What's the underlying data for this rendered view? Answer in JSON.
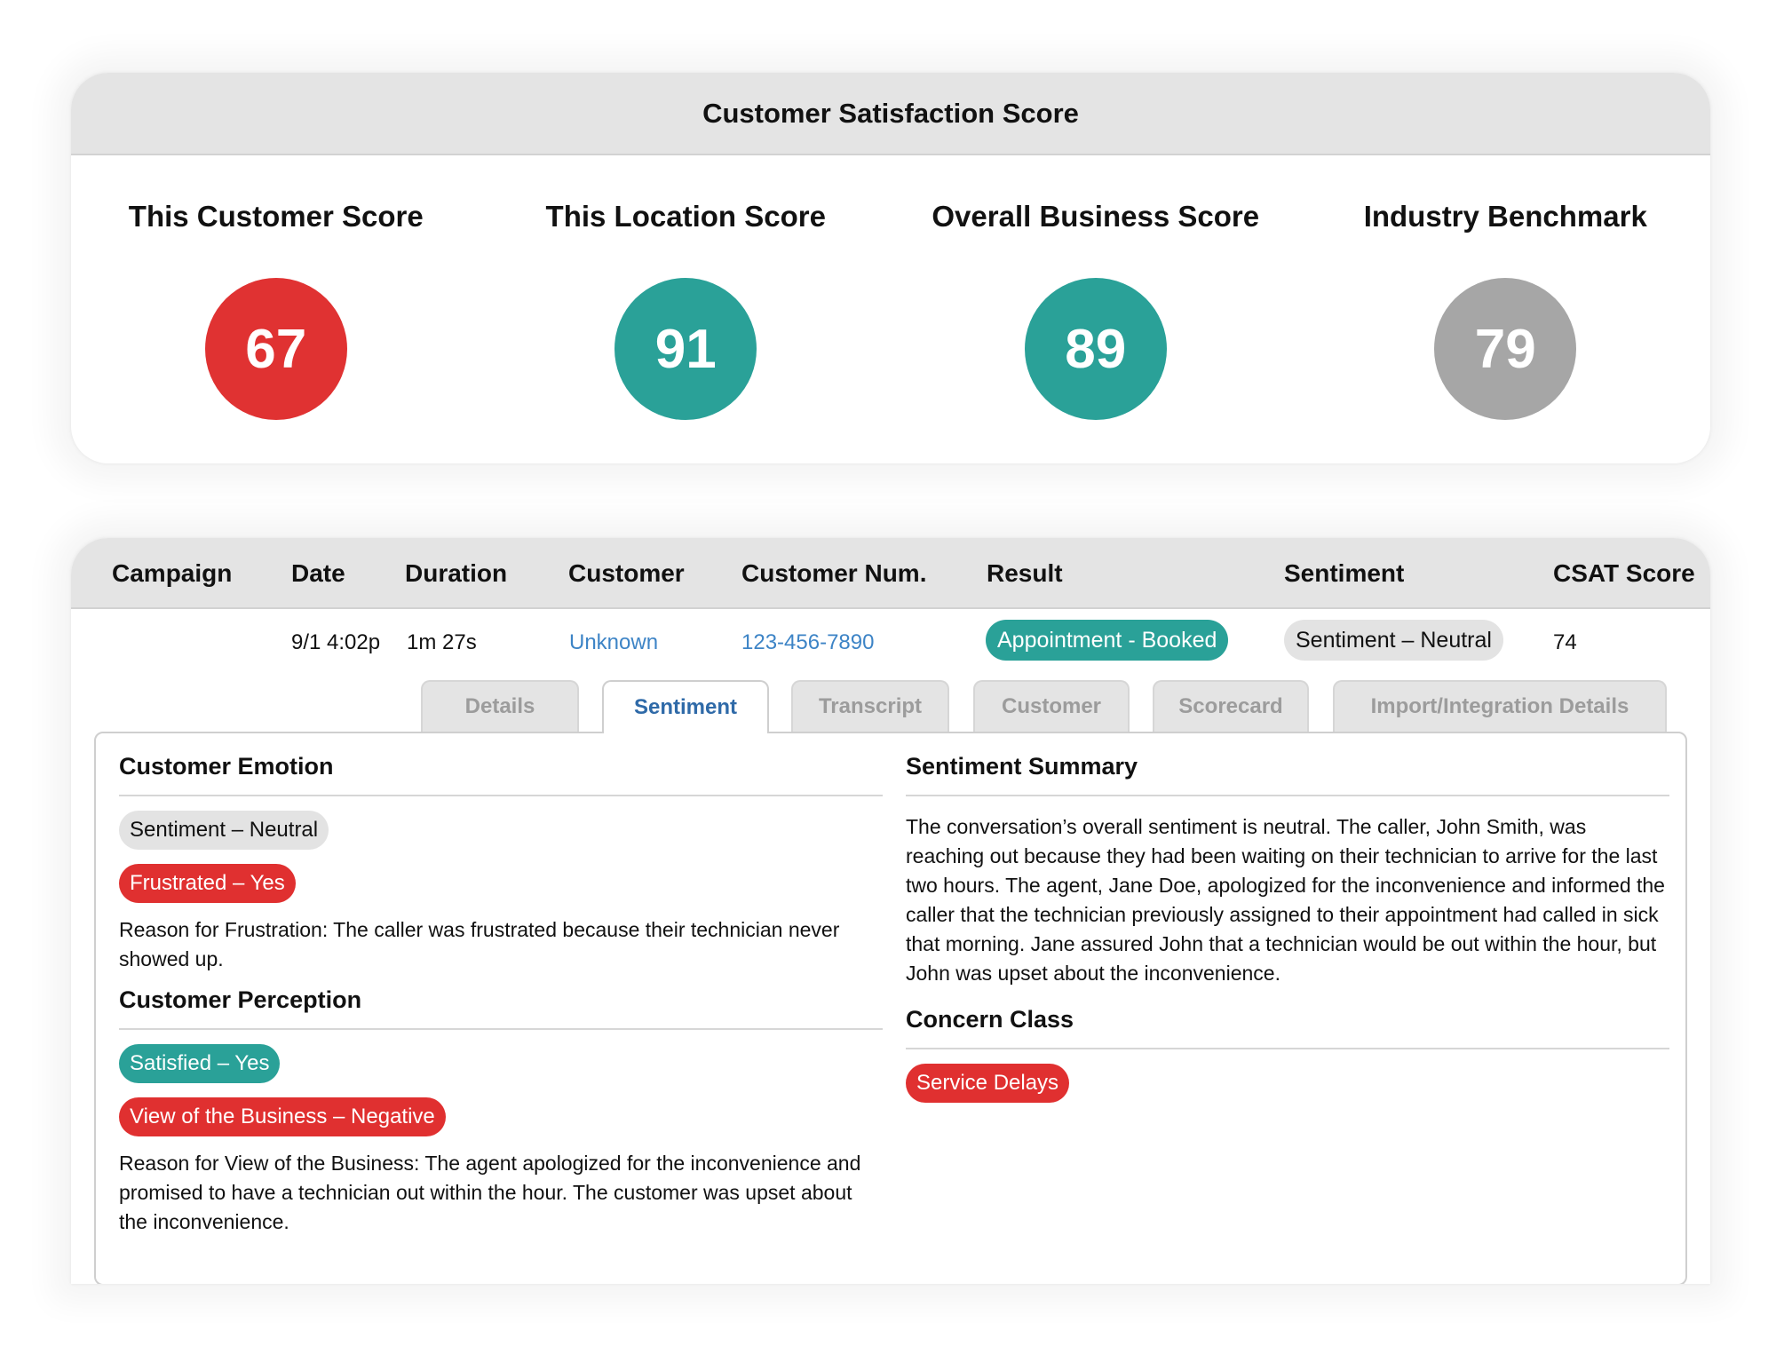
{
  "csat": {
    "title": "Customer Satisfaction Score",
    "scores": [
      {
        "label": "This Customer Score",
        "value": "67",
        "color": "#e03232"
      },
      {
        "label": "This Location Score",
        "value": "91",
        "color": "#2aa198"
      },
      {
        "label": "Overall Business Score",
        "value": "89",
        "color": "#2aa198"
      },
      {
        "label": "Industry Benchmark",
        "value": "79",
        "color": "#a6a6a6"
      }
    ]
  },
  "table": {
    "headers": [
      "Campaign",
      "Date",
      "Duration",
      "Customer",
      "Customer Num.",
      "Result",
      "Sentiment",
      "CSAT Score"
    ],
    "row": {
      "campaign": "",
      "date": "9/1 4:02p",
      "duration": "1m 27s",
      "customer": "Unknown",
      "customer_num": "123-456-7890",
      "result": "Appointment - Booked",
      "sentiment": "Sentiment – Neutral",
      "csat": "74"
    }
  },
  "tabs": [
    "Details",
    "Sentiment",
    "Transcript",
    "Customer",
    "Scorecard",
    "Import/Integration Details"
  ],
  "active_tab": "Sentiment",
  "sentiment_panel": {
    "emotion": {
      "title": "Customer Emotion",
      "badges": [
        "Sentiment – Neutral",
        "Frustrated – Yes"
      ],
      "reason": "Reason for Frustration: The caller was frustrated because their technician never showed up."
    },
    "perception": {
      "title": "Customer Perception",
      "badges": [
        "Satisfied – Yes",
        "View of the Business – Negative"
      ],
      "reason": "Reason for View of the Business: The agent apologized for the inconvenience and promised to have a technician out within the hour. The customer was upset about the inconvenience."
    },
    "summary": {
      "title": "Sentiment Summary",
      "text": "The conversation’s overall sentiment is neutral. The caller, John Smith, was reaching out because they had been waiting on their technician to arrive for the last two hours. The agent, Jane Doe, apologized for the inconvenience and informed the caller that the technician previously assigned to their appointment had called in sick that morning. Jane assured John that a technician would be out within the hour, but John was upset about the inconvenience."
    },
    "concern": {
      "title": "Concern Class",
      "badge": "Service Delays"
    }
  },
  "colors": {
    "red": "#e03232",
    "teal": "#2aa198",
    "gray": "#a6a6a6",
    "link": "#3d84c6",
    "active_tab": "#2f6aa8"
  }
}
